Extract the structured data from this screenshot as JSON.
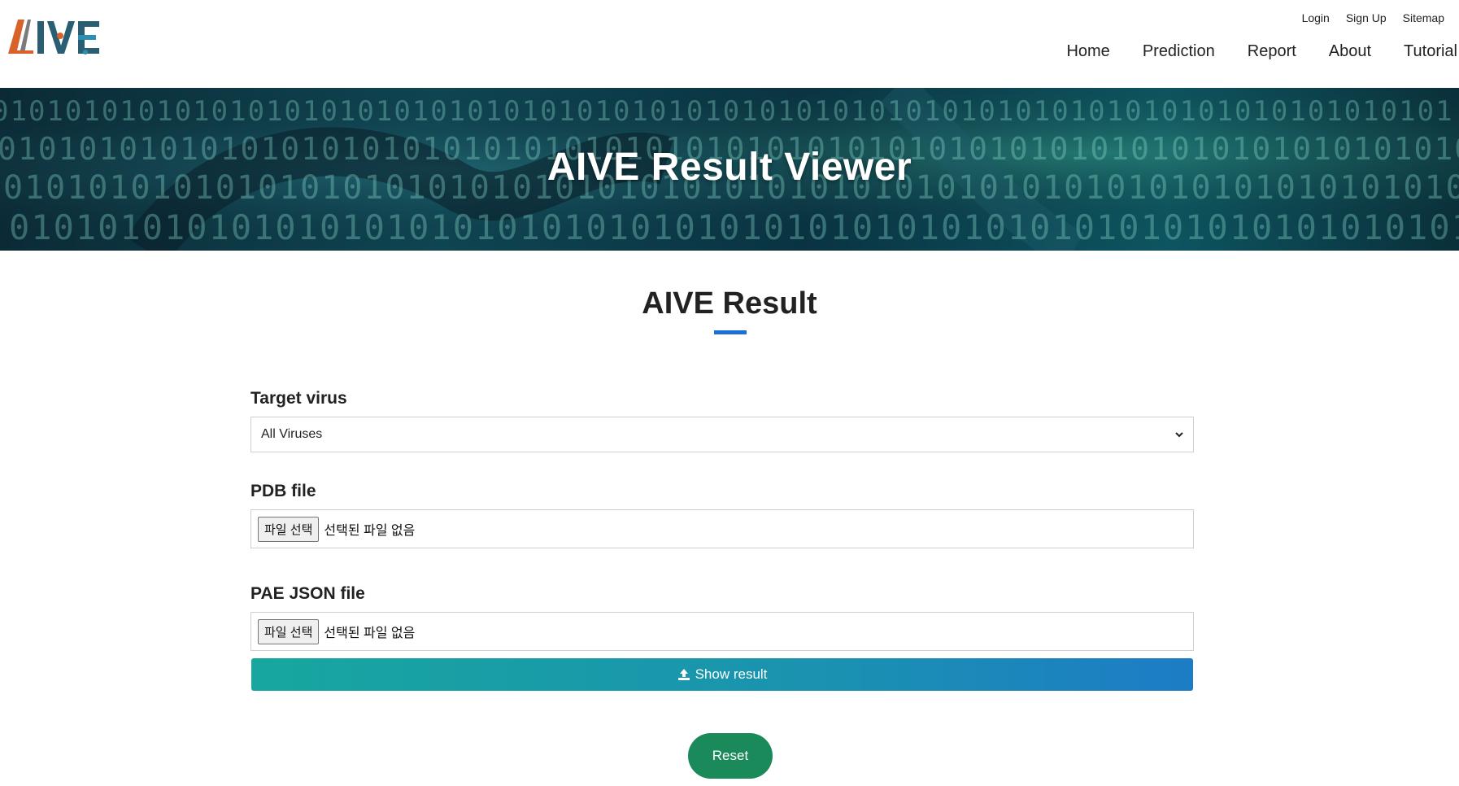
{
  "logo": {
    "text": "AIVE"
  },
  "util_nav": [
    "Login",
    "Sign Up",
    "Sitemap"
  ],
  "main_nav": [
    "Home",
    "Prediction",
    "Report",
    "About",
    "Tutorial"
  ],
  "banner": {
    "title": "AIVE Result Viewer"
  },
  "page": {
    "title": "AIVE Result",
    "accent_color": "#1a6fd6"
  },
  "form": {
    "target_virus": {
      "label": "Target virus",
      "selected": "All Viruses"
    },
    "pdb_file": {
      "label": "PDB file",
      "button": "파일 선택",
      "status": "선택된 파일 없음"
    },
    "pae_json_file": {
      "label": "PAE JSON file",
      "button": "파일 선택",
      "status": "선택된 파일 없음"
    },
    "show_button": {
      "label": "Show result",
      "icon": "upload-icon"
    },
    "reset_button": {
      "label": "Reset",
      "color": "#1b8a5a"
    }
  }
}
